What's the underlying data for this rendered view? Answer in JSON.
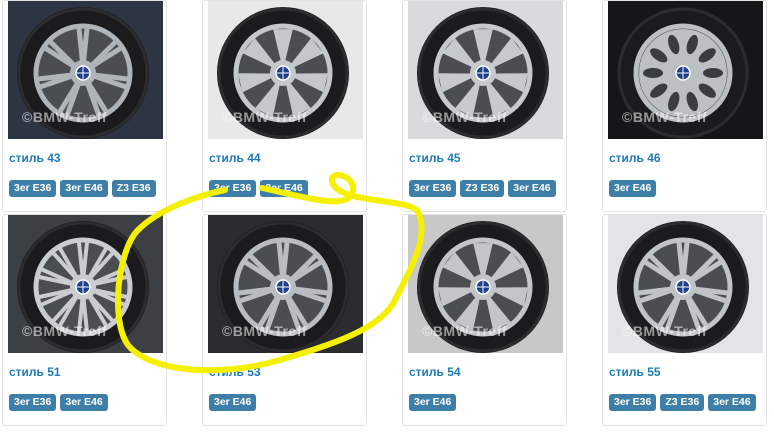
{
  "watermark": "©BMW-Treff",
  "wheels": [
    {
      "name": "стиль 43",
      "tags": [
        "3er E36",
        "3er E46",
        "Z3 E36"
      ],
      "bg": "#2d3442",
      "rim": "#aeb4b9",
      "spokes": "double"
    },
    {
      "name": "стиль 44",
      "tags": [
        "3er E36",
        "3er E46"
      ],
      "bg": "#e8e8e8",
      "rim": "#c4c8cb",
      "spokes": "star7"
    },
    {
      "name": "стиль 45",
      "tags": [
        "3er E36",
        "Z3 E36",
        "3er E46"
      ],
      "bg": "#d9dadb",
      "rim": "#c7cacc",
      "spokes": "star7"
    },
    {
      "name": "стиль 46",
      "tags": [
        "3er E46"
      ],
      "bg": "#151617",
      "rim": "#bcc0c3",
      "spokes": "holes"
    },
    {
      "name": "стиль 51",
      "tags": [
        "3er E36",
        "3er E46"
      ],
      "bg": "#3c3f44",
      "rim": "#c9cdd0",
      "spokes": "multi"
    },
    {
      "name": "стиль 53",
      "tags": [
        "3er E46"
      ],
      "bg": "#2a2c30",
      "rim": "#b9bdc1",
      "spokes": "double"
    },
    {
      "name": "стиль 54",
      "tags": [
        "3er E46"
      ],
      "bg": "#c8c8c8",
      "rim": "#c3c6c9",
      "spokes": "star7"
    },
    {
      "name": "стиль 55",
      "tags": [
        "3er E36",
        "Z3 E36",
        "3er E46"
      ],
      "bg": "#e3e4e5",
      "rim": "#c0c4c7",
      "spokes": "double"
    }
  ],
  "highlight": {
    "color": "#f4f000"
  },
  "colors": {
    "accent": "#1d7ab8",
    "tag": "#3d7fa8"
  }
}
